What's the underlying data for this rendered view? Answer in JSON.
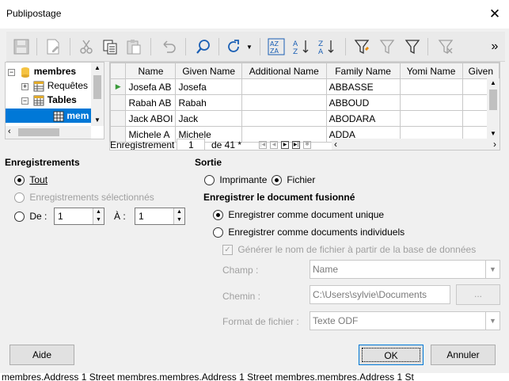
{
  "window": {
    "title": "Publipostage",
    "close_glyph": "✕"
  },
  "tree": {
    "items": [
      {
        "label": "membres",
        "expander": "−"
      },
      {
        "label": "Requêtes",
        "expander": "+"
      },
      {
        "label": "Tables",
        "expander": "−"
      },
      {
        "label": "mem",
        "selected": true
      }
    ]
  },
  "grid": {
    "columns": [
      "Name",
      "Given Name",
      "Additional Name",
      "Family Name",
      "Yomi Name",
      "Given"
    ],
    "rows": [
      {
        "name": "Josefa AB",
        "given": "Josefa",
        "additional": "",
        "family": "ABBASSE",
        "yomi": "",
        "given2": ""
      },
      {
        "name": "Rabah AB",
        "given": "Rabah",
        "additional": "",
        "family": "ABBOUD",
        "yomi": "",
        "given2": ""
      },
      {
        "name": "Jack ABOI",
        "given": "Jack",
        "additional": "",
        "family": "ABODARA",
        "yomi": "",
        "given2": ""
      },
      {
        "name": "Michele A",
        "given": "Michele",
        "additional": "",
        "family": "ADDA",
        "yomi": "",
        "given2": ""
      }
    ],
    "nav_label": "Enregistrement",
    "record_value": "1",
    "record_total": "de 41 *"
  },
  "records": {
    "heading": "Enregistrements",
    "all": "Tout",
    "selected": "Enregistrements sélectionnés",
    "from_label": "De :",
    "from_value": "1",
    "to_label": "À :",
    "to_value": "1"
  },
  "output": {
    "heading": "Sortie",
    "printer": "Imprimante",
    "file": "Fichier",
    "save_heading": "Enregistrer le document fusionné",
    "single_doc": "Enregistrer comme document unique",
    "individual_docs": "Enregistrer comme documents individuels",
    "generate_filename": "Générer le nom de fichier à partir de la base de données",
    "field_label": "Champ :",
    "field_value": "Name",
    "path_label": "Chemin :",
    "path_value": "C:\\Users\\sylvie\\Documents",
    "browse_label": "...",
    "format_label": "Format de fichier :",
    "format_value": "Texte ODF"
  },
  "buttons": {
    "help": "Aide",
    "ok": "OK",
    "cancel": "Annuler"
  },
  "background_text": "membres.Address 1   Street  membres.membres.Address 1   Street  membres.membres.Address 1   St",
  "colors": {
    "selection": "#0078d7",
    "accent": "#0078d7",
    "folder": "#f5c342"
  }
}
